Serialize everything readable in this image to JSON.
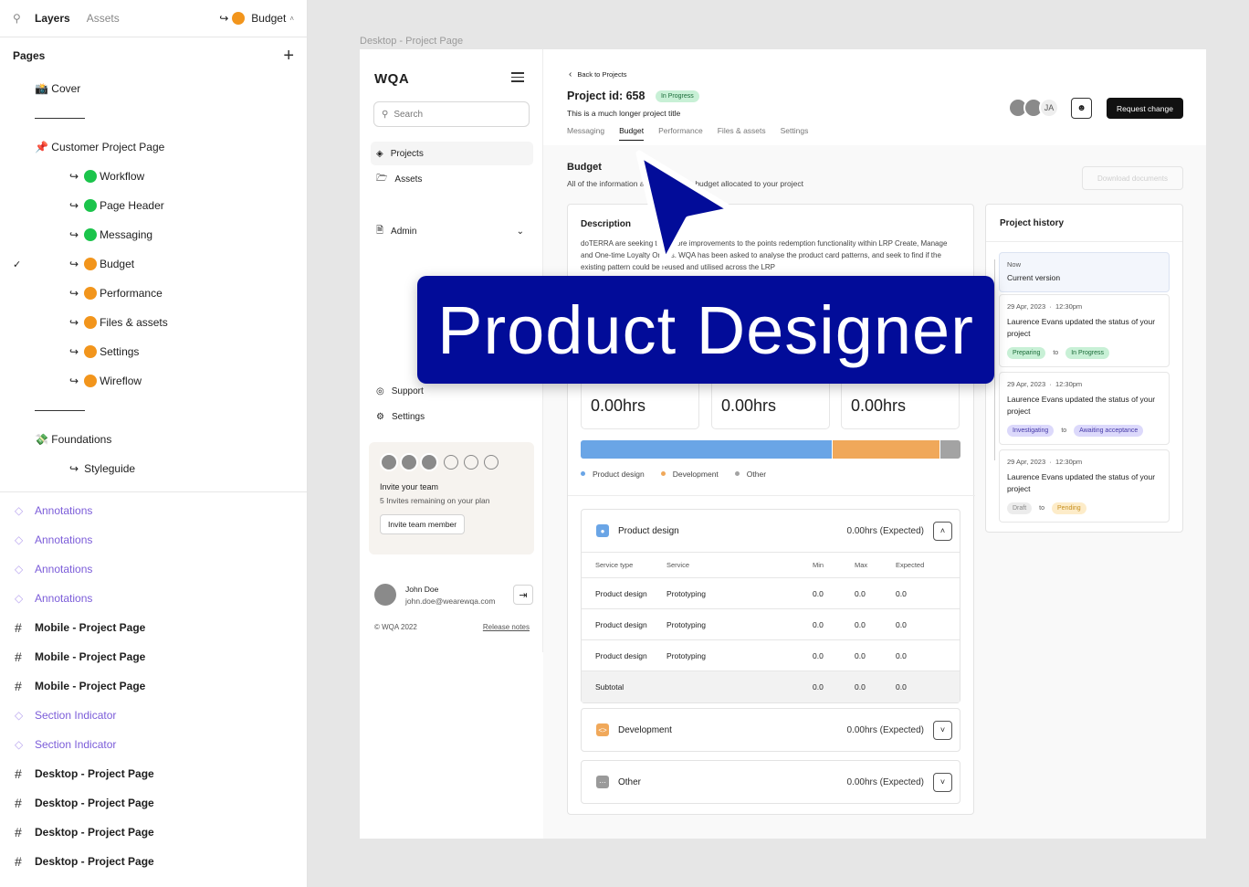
{
  "layers_panel": {
    "tab_layers": "Layers",
    "tab_assets": "Assets",
    "current_page": "Budget",
    "pages_heading": "Pages",
    "pages": [
      {
        "label": "📸 Cover",
        "indent": 0
      },
      {
        "label": "",
        "separator": true
      },
      {
        "label": "📌 Customer Project Page",
        "indent": 0
      },
      {
        "label": "Workflow",
        "indent": 1,
        "dot": "green"
      },
      {
        "label": "Page Header",
        "indent": 1,
        "dot": "green"
      },
      {
        "label": "Messaging",
        "indent": 1,
        "dot": "green"
      },
      {
        "label": "Budget",
        "indent": 1,
        "dot": "orange",
        "checked": true
      },
      {
        "label": "Performance",
        "indent": 1,
        "dot": "orange"
      },
      {
        "label": "Files & assets",
        "indent": 1,
        "dot": "orange"
      },
      {
        "label": "Settings",
        "indent": 1,
        "dot": "orange"
      },
      {
        "label": "Wireflow",
        "indent": 1,
        "dot": "orange"
      },
      {
        "label": "",
        "separator": true
      },
      {
        "label": "💸 Foundations",
        "indent": 0
      },
      {
        "label": "Styleguide",
        "indent": 1
      }
    ],
    "layers": [
      {
        "label": "Annotations",
        "type": "component"
      },
      {
        "label": "Annotations",
        "type": "component"
      },
      {
        "label": "Annotations",
        "type": "component"
      },
      {
        "label": "Annotations",
        "type": "component"
      },
      {
        "label": "Mobile - Project Page",
        "type": "frame"
      },
      {
        "label": "Mobile - Project Page",
        "type": "frame"
      },
      {
        "label": "Mobile - Project Page",
        "type": "frame"
      },
      {
        "label": "Section Indicator",
        "type": "component"
      },
      {
        "label": "Section Indicator",
        "type": "component"
      },
      {
        "label": "Desktop - Project Page",
        "type": "frame"
      },
      {
        "label": "Desktop - Project Page",
        "type": "frame"
      },
      {
        "label": "Desktop - Project Page",
        "type": "frame"
      },
      {
        "label": "Desktop - Project Page",
        "type": "frame"
      }
    ]
  },
  "canvas": {
    "frame_label": "Desktop - Project Page",
    "overlay_text": "Product Designer"
  },
  "sidebar": {
    "logo": "WQA",
    "search_placeholder": "Search",
    "nav": {
      "projects": "Projects",
      "assets": "Assets",
      "admin": "Admin",
      "support": "Support",
      "settings": "Settings"
    },
    "team": {
      "title": "Invite your team",
      "subtitle": "5 Invites remaining on your plan",
      "button": "Invite team member"
    },
    "user": {
      "name": "John Doe",
      "email": "john.doe@wearewqa.com"
    },
    "copyright": "© WQA 2022",
    "release_notes": "Release notes"
  },
  "header": {
    "back": "Back to Projects",
    "project_id": "Project id: 658",
    "status": "In Progress",
    "subtitle": "This is a much longer project title",
    "tabs": [
      "Messaging",
      "Budget",
      "Performance",
      "Files & assets",
      "Settings"
    ],
    "active_tab": "Budget",
    "avatar_initials": "JA",
    "request_button": "Request change"
  },
  "budget": {
    "title": "Budget",
    "subtitle": "All of the information associated with budget allocated to your project",
    "download": "Download documents",
    "description_heading": "Description",
    "description": "doTERRA are seeking to explore improvements to the points redemption functionality within LRP Create, Manage and One-time Loyalty Orders. WQA has been asked to analyse the product card patterns, and seek to find if the existing pattern could be reused and utilised across the LRP",
    "stats": [
      "0.00hrs",
      "0.00hrs",
      "0.00hrs"
    ],
    "distribution": [
      {
        "name": "Product design",
        "share": 0.66,
        "color": "#6aa5e6"
      },
      {
        "name": "Development",
        "share": 0.285,
        "color": "#f0a85a"
      },
      {
        "name": "Other",
        "share": 0.055,
        "color": "#a3a3a3"
      }
    ],
    "sections": [
      {
        "name": "Product design",
        "total": "0.00hrs (Expected)",
        "expanded": true,
        "color": "#6aa5e6"
      },
      {
        "name": "Development",
        "total": "0.00hrs (Expected)",
        "expanded": false,
        "color": "#f0a85a"
      },
      {
        "name": "Other",
        "total": "0.00hrs (Expected)",
        "expanded": false,
        "color": "#9a9a9a"
      }
    ],
    "table": {
      "headers": [
        "Service type",
        "Service",
        "Min",
        "Max",
        "Expected"
      ],
      "rows": [
        [
          "Product design",
          "Prototyping",
          "0.0",
          "0.0",
          "0.0"
        ],
        [
          "Product design",
          "Prototyping",
          "0.0",
          "0.0",
          "0.0"
        ],
        [
          "Product design",
          "Prototyping",
          "0.0",
          "0.0",
          "0.0"
        ]
      ],
      "subtotal": [
        "Subtotal",
        "",
        "0.0",
        "0.0",
        "0.0"
      ]
    }
  },
  "history": {
    "title": "Project history",
    "now_label": "Now",
    "now_value": "Current version",
    "entries": [
      {
        "date": "29 Apr, 2023",
        "time": "12:30pm",
        "actor": "Laurence Evans",
        "text": " updated the status of your project",
        "from": "Preparing",
        "to": "In Progress",
        "from_style": "g",
        "to_style": "g"
      },
      {
        "date": "29 Apr, 2023",
        "time": "12:30pm",
        "actor": "Laurence Evans",
        "text": " updated the status of your project",
        "from": "Investigating",
        "to": "Awaiting acceptance",
        "from_style": "b",
        "to_style": "b"
      },
      {
        "date": "29 Apr, 2023",
        "time": "12:30pm",
        "actor": "Laurence Evans",
        "text": " updated the status of your project",
        "from": "Draft",
        "to": "Pending",
        "from_style": "gray",
        "to_style": "o"
      }
    ],
    "to_word": "to"
  }
}
